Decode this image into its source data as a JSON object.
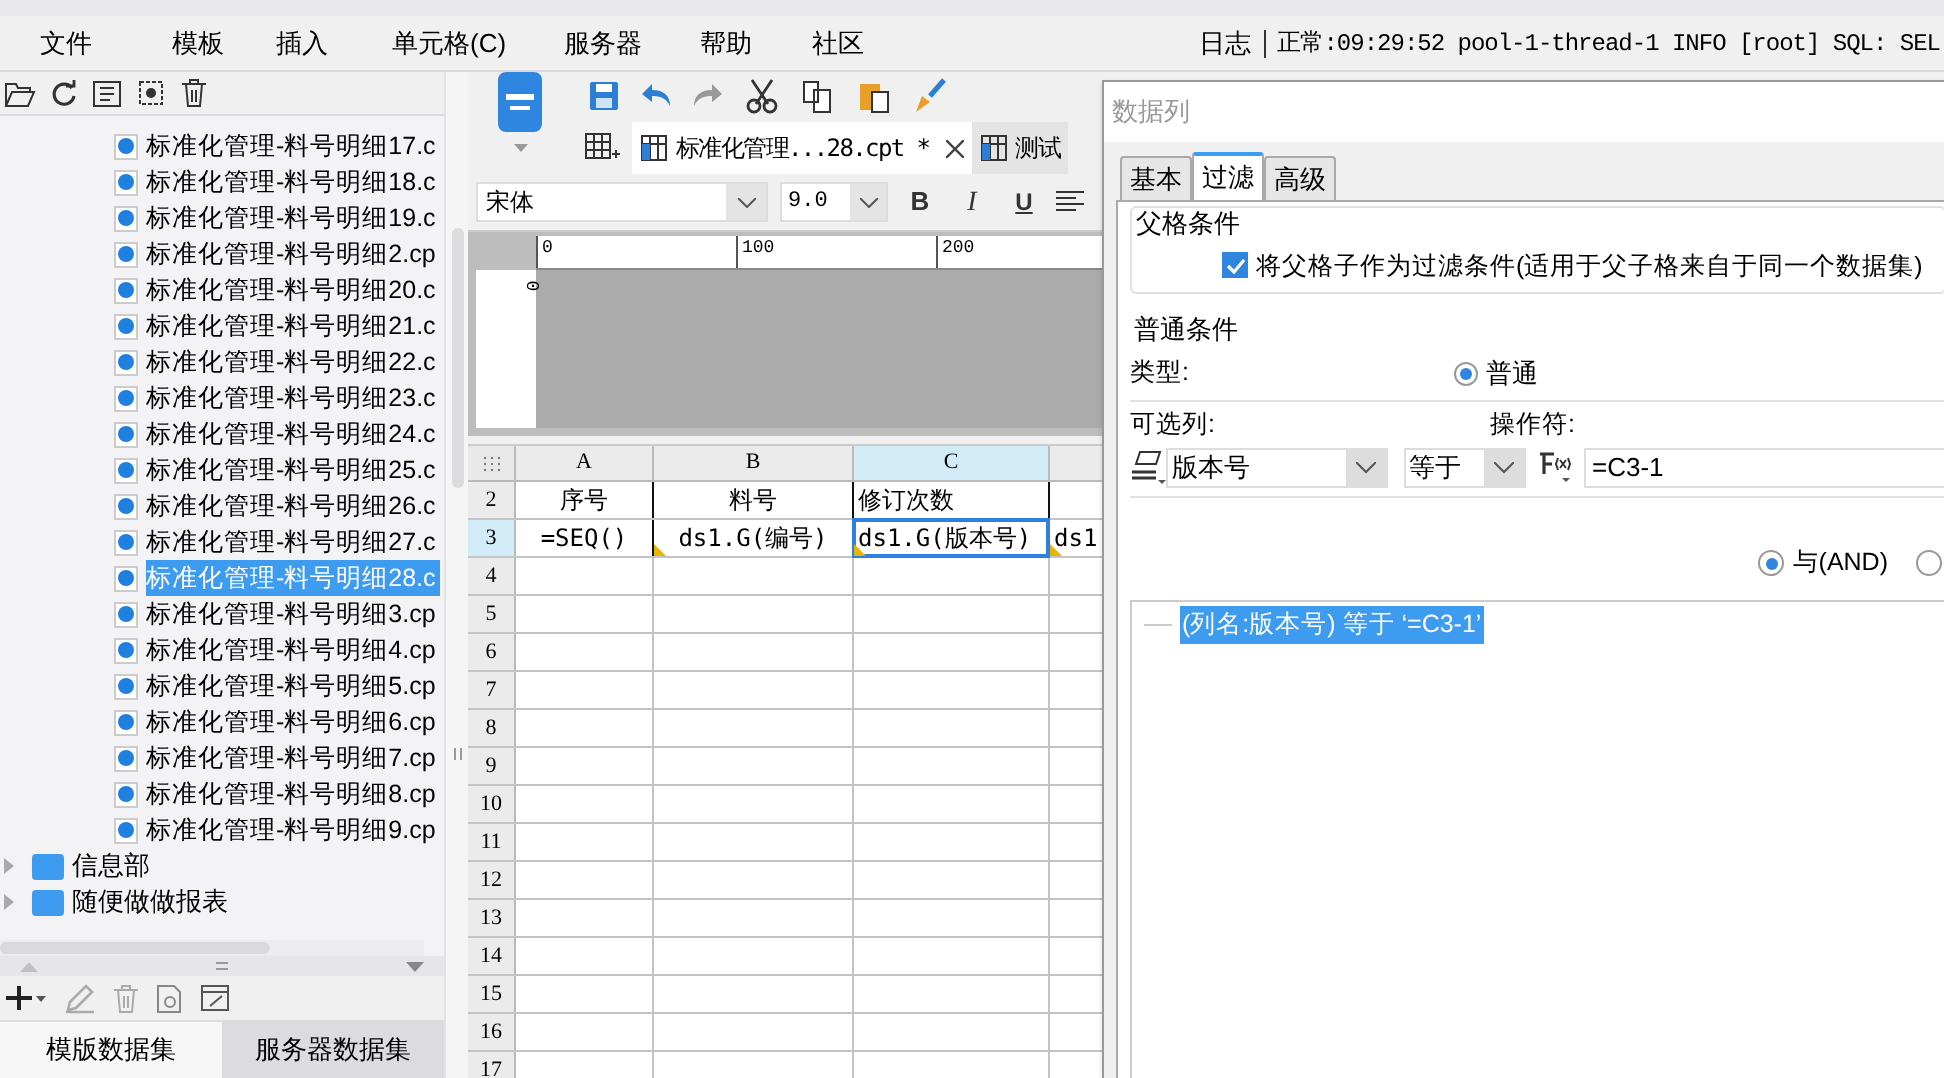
{
  "menu_bar": {
    "items": [
      "文件",
      "模板",
      "插入",
      "单元格(C)",
      "服务器",
      "帮助",
      "社区"
    ],
    "log_label": "日志",
    "status": "正常:09:29:52 pool-1-thread-1 INFO [root] SQL: SEL"
  },
  "template_tree": {
    "files": [
      {
        "label": "标准化管理-料号明细17.c",
        "selected": false
      },
      {
        "label": "标准化管理-料号明细18.c",
        "selected": false
      },
      {
        "label": "标准化管理-料号明细19.c",
        "selected": false
      },
      {
        "label": "标准化管理-料号明细2.cp",
        "selected": false
      },
      {
        "label": "标准化管理-料号明细20.c",
        "selected": false
      },
      {
        "label": "标准化管理-料号明细21.c",
        "selected": false
      },
      {
        "label": "标准化管理-料号明细22.c",
        "selected": false
      },
      {
        "label": "标准化管理-料号明细23.c",
        "selected": false
      },
      {
        "label": "标准化管理-料号明细24.c",
        "selected": false
      },
      {
        "label": "标准化管理-料号明细25.c",
        "selected": false
      },
      {
        "label": "标准化管理-料号明细26.c",
        "selected": false
      },
      {
        "label": "标准化管理-料号明细27.c",
        "selected": false
      },
      {
        "label": "标准化管理-料号明细28.c",
        "selected": true
      },
      {
        "label": "标准化管理-料号明细3.cp",
        "selected": false
      },
      {
        "label": "标准化管理-料号明细4.cp",
        "selected": false
      },
      {
        "label": "标准化管理-料号明细5.cp",
        "selected": false
      },
      {
        "label": "标准化管理-料号明细6.cp",
        "selected": false
      },
      {
        "label": "标准化管理-料号明细7.cp",
        "selected": false
      },
      {
        "label": "标准化管理-料号明细8.cp",
        "selected": false
      },
      {
        "label": "标准化管理-料号明细9.cp",
        "selected": false
      }
    ],
    "folders": [
      "信息部",
      "随便做做报表"
    ]
  },
  "dataset_tabs": [
    {
      "label": "模版数据集",
      "selected": true
    },
    {
      "label": "服务器数据集",
      "selected": false
    }
  ],
  "editor_tabs": [
    {
      "label": "标准化管理...28.cpt *",
      "selected": true,
      "closable": true
    },
    {
      "label": "测试",
      "selected": false,
      "closable": false
    }
  ],
  "format_bar": {
    "font": "宋体",
    "size": "9.0",
    "bold": "B",
    "italic": "I",
    "underline": "U"
  },
  "ruler": {
    "marks": [
      "0",
      "100",
      "200"
    ],
    "vertical_mark": "0"
  },
  "sheet": {
    "columns": [
      {
        "label": "A",
        "selected": false
      },
      {
        "label": "B",
        "selected": false
      },
      {
        "label": "C",
        "selected": true
      }
    ],
    "rows": [
      {
        "number": "2",
        "selected": false,
        "cells": [
          {
            "text": "序号",
            "kind": "text",
            "selected": false
          },
          {
            "text": "料号",
            "kind": "text",
            "selected": false
          },
          {
            "text": "修订次数",
            "kind": "text",
            "selected": false
          }
        ]
      },
      {
        "number": "3",
        "selected": true,
        "cells": [
          {
            "text": "=SEQ()",
            "kind": "text",
            "selected": false
          },
          {
            "text": "ds1.G(编号)",
            "kind": "data",
            "selected": false
          },
          {
            "text": "ds1.G(版本号)",
            "kind": "data",
            "selected": true
          },
          {
            "text": "ds1",
            "kind": "data",
            "selected": false
          }
        ]
      },
      {
        "number": "4",
        "selected": false
      },
      {
        "number": "5",
        "selected": false
      },
      {
        "number": "6",
        "selected": false
      },
      {
        "number": "7",
        "selected": false
      },
      {
        "number": "8",
        "selected": false
      },
      {
        "number": "9",
        "selected": false
      },
      {
        "number": "10",
        "selected": false
      },
      {
        "number": "11",
        "selected": false
      },
      {
        "number": "12",
        "selected": false
      },
      {
        "number": "13",
        "selected": false
      },
      {
        "number": "14",
        "selected": false
      },
      {
        "number": "15",
        "selected": false
      },
      {
        "number": "16",
        "selected": false
      },
      {
        "number": "17",
        "selected": false
      }
    ]
  },
  "dialog": {
    "title": "数据列",
    "tabs": [
      {
        "label": "基本",
        "selected": false
      },
      {
        "label": "过滤",
        "selected": true
      },
      {
        "label": "高级",
        "selected": false
      }
    ],
    "parent_group": {
      "title": "父格条件",
      "checkbox": {
        "label": "将父格子作为过滤条件(适用于父子格来自于同一个数据集)",
        "checked": true
      }
    },
    "normal_group": {
      "title": "普通条件",
      "type_label": "类型:",
      "type_option": {
        "label": "普通",
        "selected": true
      },
      "column_label": "可选列:",
      "operator_label": "操作符:",
      "column": "版本号",
      "operator": "等于",
      "value": "=C3-1",
      "joins": [
        {
          "label": "与(AND)",
          "selected": true
        },
        {
          "selected": false
        }
      ],
      "conditions": [
        {
          "text": "(列名:版本号) 等于 ‘=C3-1’",
          "selected": true
        }
      ]
    }
  }
}
